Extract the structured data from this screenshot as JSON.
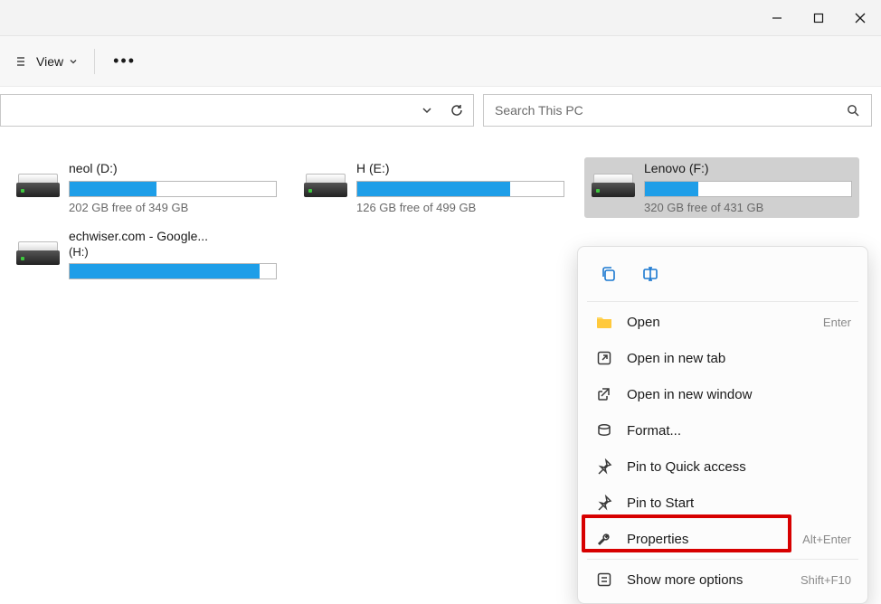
{
  "window": {
    "controls": {
      "minimize": "minimize",
      "maximize": "maximize",
      "close": "close"
    }
  },
  "toolbar": {
    "view_label": "View",
    "more_label": "•••"
  },
  "searchbar": {
    "placeholder": "Search This PC"
  },
  "drives": [
    {
      "label": "neol (D:)",
      "free": "202 GB free of 349 GB",
      "fill_pct": 42
    },
    {
      "label": "H (E:)",
      "free": "126 GB free of 499 GB",
      "fill_pct": 74
    },
    {
      "label": "Lenovo (F:)",
      "free": "320 GB free of 431 GB",
      "fill_pct": 26,
      "selected": true
    },
    {
      "label": "echwiser.com - Google...",
      "free": "",
      "fill_pct": 92,
      "second_line": "(H:)"
    }
  ],
  "context_menu": {
    "items": [
      {
        "icon": "folder",
        "label": "Open",
        "shortcut": "Enter"
      },
      {
        "icon": "newtab",
        "label": "Open in new tab",
        "shortcut": ""
      },
      {
        "icon": "newwin",
        "label": "Open in new window",
        "shortcut": ""
      },
      {
        "icon": "format",
        "label": "Format...",
        "shortcut": ""
      },
      {
        "icon": "pinqa",
        "label": "Pin to Quick access",
        "shortcut": ""
      },
      {
        "icon": "pinst",
        "label": "Pin to Start",
        "shortcut": ""
      },
      {
        "icon": "props",
        "label": "Properties",
        "shortcut": "Alt+Enter",
        "highlighted": true
      },
      {
        "icon": "more",
        "label": "Show more options",
        "shortcut": "Shift+F10"
      }
    ]
  }
}
